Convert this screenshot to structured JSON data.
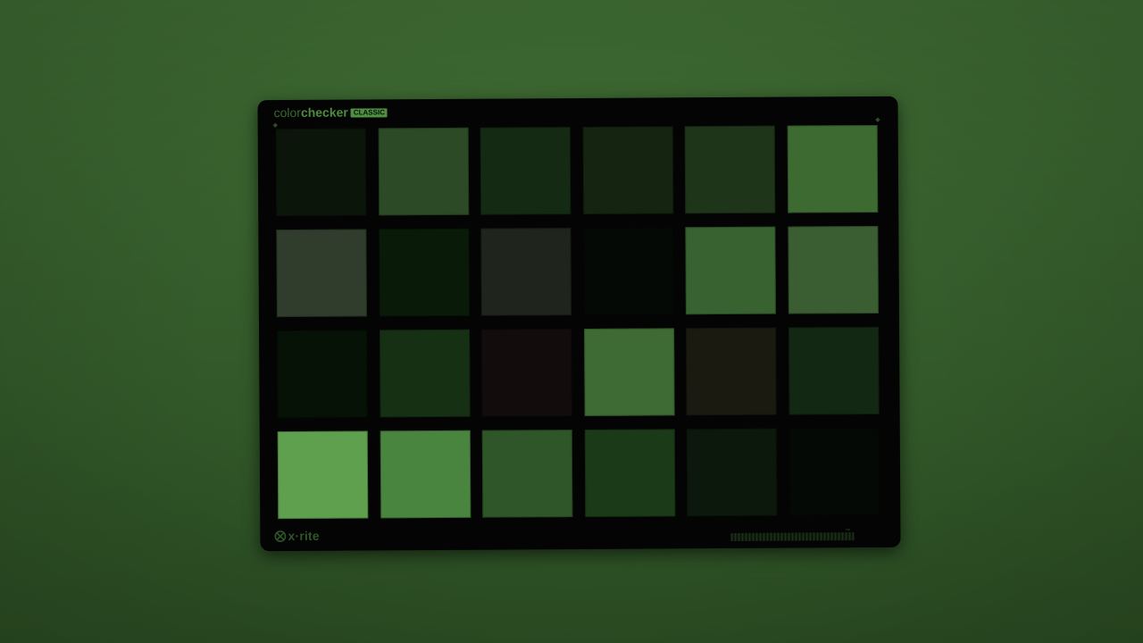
{
  "card": {
    "brand_word_light": "color",
    "brand_word_bold": "checker",
    "brand_badge": "CLASSIC",
    "logo_text": "x·rite",
    "logo_icon": "xrite-logo-icon",
    "colors": {
      "background_top": "#3f6c33",
      "background_bottom": "#2c4f24",
      "card_body": "#030403",
      "brand_accent": "#4e8c3e"
    }
  },
  "patches": {
    "rows": 4,
    "columns": 6,
    "colors": [
      "#0b150a",
      "#2c4a25",
      "#152a12",
      "#142410",
      "#1e351a",
      "#3c6a31",
      "#303c2c",
      "#0a1a09",
      "#1f241c",
      "#050905",
      "#386230",
      "#3a5e32",
      "#051205",
      "#163014",
      "#120d0c",
      "#3e6a33",
      "#1a1a10",
      "#132812",
      "#5ea04d",
      "#4a8540",
      "#2f5628",
      "#1b3a17",
      "#0c180b",
      "#050905"
    ]
  }
}
